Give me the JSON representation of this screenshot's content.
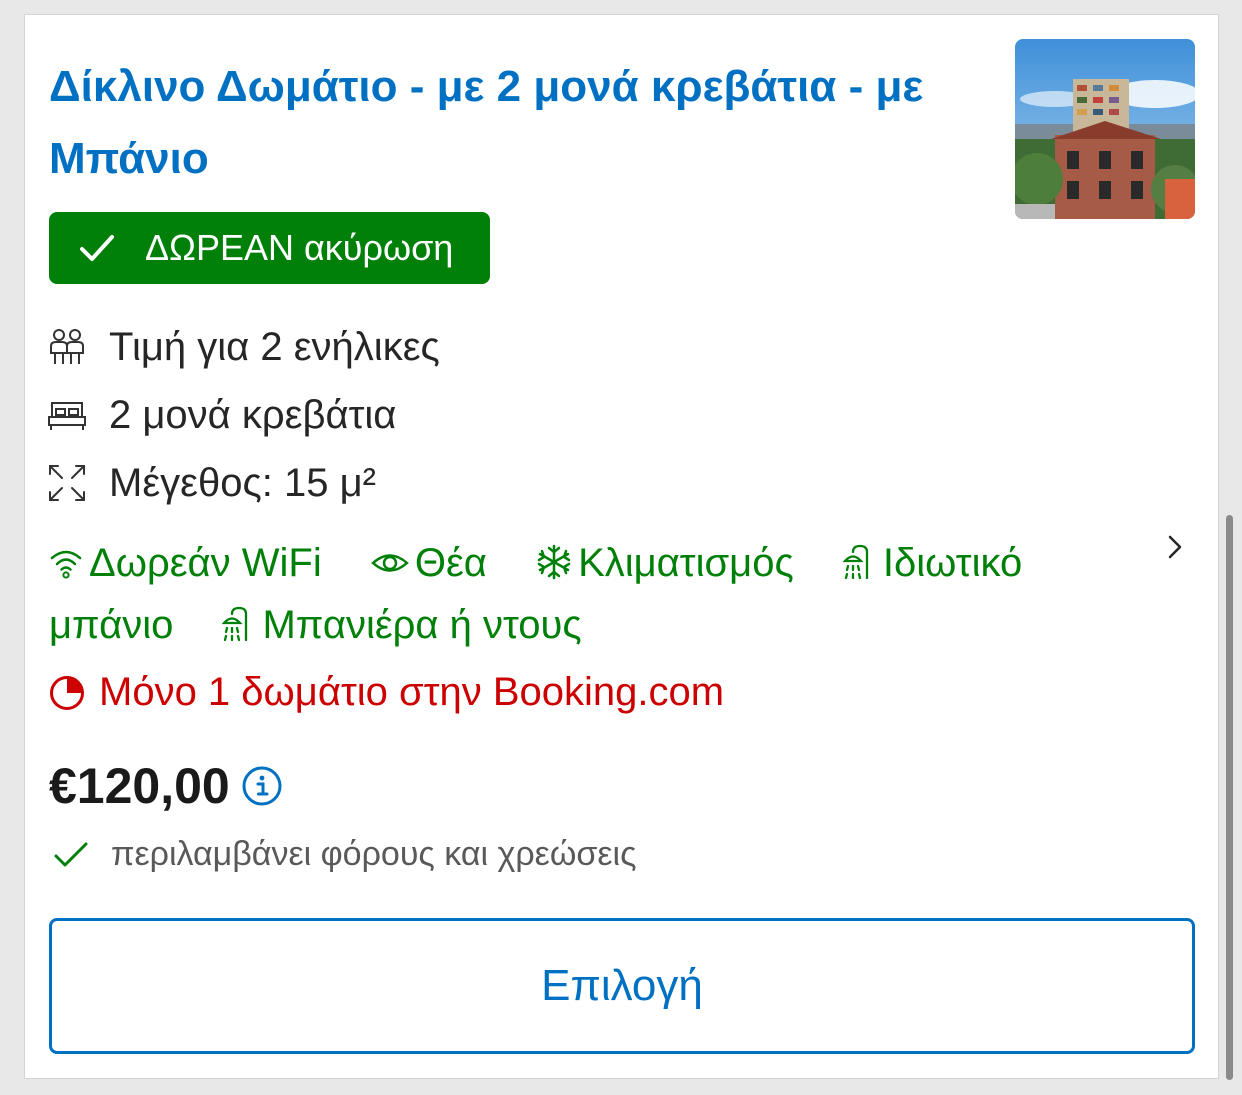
{
  "room": {
    "title": "Δίκλινο Δωμάτιο - με 2 μονά κρεβάτια - με Μπάνιο"
  },
  "cancellation_badge": "ΔΩΡΕΑΝ ακύρωση",
  "facts": [
    {
      "icon": "people-icon",
      "label": "Τιμή για 2 ενήλικες"
    },
    {
      "icon": "bed-icon",
      "label": "2 μονά κρεβάτια"
    },
    {
      "icon": "room-size-icon",
      "label": "Μέγεθος: 15 μ²"
    }
  ],
  "amenities": [
    {
      "icon": "wifi-icon",
      "label": "Δωρεάν WiFi"
    },
    {
      "icon": "eye-icon",
      "label": "Θέα"
    },
    {
      "icon": "snowflake-icon",
      "label": "Κλιματισμός"
    },
    {
      "icon": "shower-icon",
      "label": "Ιδιωτικό μπάνιο"
    },
    {
      "icon": "shower-icon",
      "label": "Μπανιέρα ή ντους"
    }
  ],
  "scarcity": "Μόνο 1 δωμάτιο στην Booking.com",
  "price": {
    "amount": "€120,00",
    "taxes_note": "περιλαμβάνει φόρους και χρεώσεις"
  },
  "select_button": "Επιλογή",
  "colors": {
    "brand_blue": "#0071c2",
    "success_green": "#008009",
    "urgency_red": "#cc0000"
  }
}
